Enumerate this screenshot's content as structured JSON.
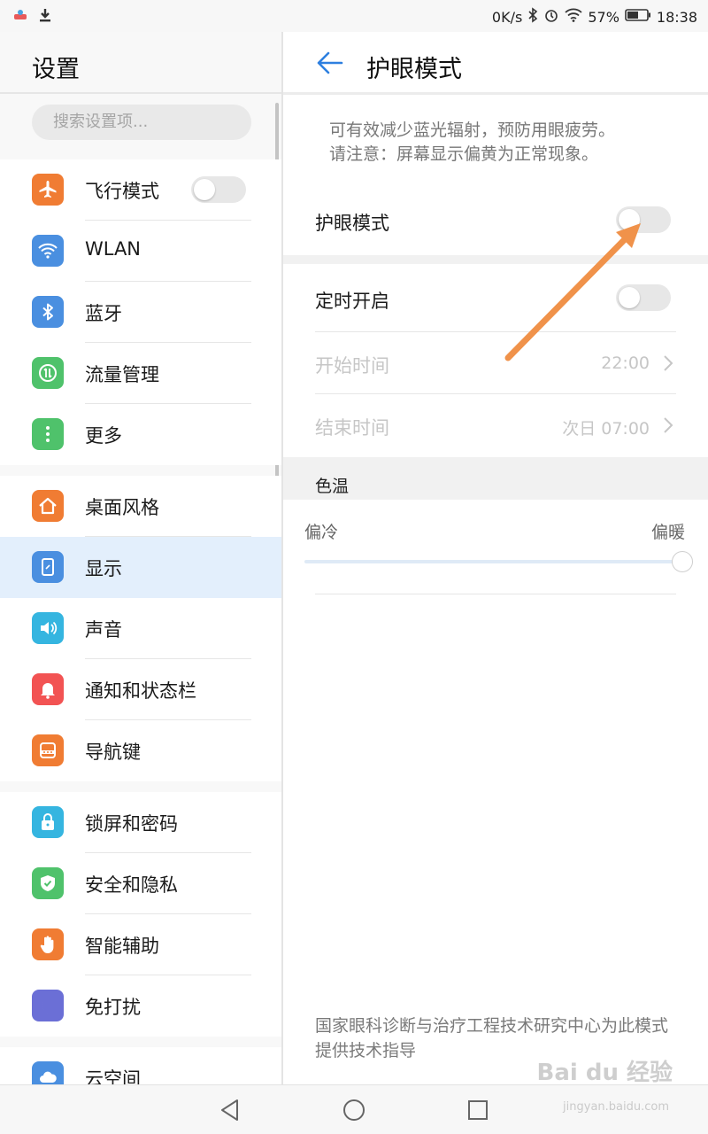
{
  "status_bar": {
    "speed": "0K/s",
    "battery": "57%",
    "time": "18:38"
  },
  "left_panel": {
    "title": "设置",
    "search_placeholder": "搜索设置项...",
    "groups": [
      {
        "items": [
          {
            "label": "飞行模式",
            "icon": "airplane-icon",
            "color": "#f07c33",
            "toggle": false
          },
          {
            "label": "WLAN",
            "icon": "wifi-icon",
            "color": "#4a8fe0"
          },
          {
            "label": "蓝牙",
            "icon": "bluetooth-icon",
            "color": "#4a8fe0"
          },
          {
            "label": "流量管理",
            "icon": "data-usage-icon",
            "color": "#4fc26b"
          },
          {
            "label": "更多",
            "icon": "more-icon",
            "color": "#4fc26b"
          }
        ]
      },
      {
        "items": [
          {
            "label": "桌面风格",
            "icon": "home-icon",
            "color": "#f07c33"
          },
          {
            "label": "显示",
            "icon": "display-icon",
            "color": "#4a8fe0",
            "active": true
          },
          {
            "label": "声音",
            "icon": "sound-icon",
            "color": "#35b5e0"
          },
          {
            "label": "通知和状态栏",
            "icon": "bell-icon",
            "color": "#f25353"
          },
          {
            "label": "导航键",
            "icon": "navigation-key-icon",
            "color": "#f07c33"
          }
        ]
      },
      {
        "items": [
          {
            "label": "锁屏和密码",
            "icon": "lock-icon",
            "color": "#35b5e0"
          },
          {
            "label": "安全和隐私",
            "icon": "shield-icon",
            "color": "#4fc26b"
          },
          {
            "label": "智能辅助",
            "icon": "hand-icon",
            "color": "#f07c33"
          },
          {
            "label": "免打扰",
            "icon": "moon-icon",
            "color": "#6b6fd6"
          }
        ]
      },
      {
        "items": [
          {
            "label": "云空间",
            "icon": "cloud-icon",
            "color": "#4a8fe0"
          }
        ]
      }
    ]
  },
  "right_panel": {
    "title": "护眼模式",
    "description_line1": "可有效减少蓝光辐射，预防用眼疲劳。",
    "description_line2": "请注意：屏幕显示偏黄为正常现象。",
    "eye_mode_label": "护眼模式",
    "eye_mode_on": false,
    "schedule_label": "定时开启",
    "schedule_on": false,
    "start_time_label": "开始时间",
    "start_time_value": "22:00",
    "end_time_label": "结束时间",
    "end_time_value": "次日 07:00",
    "color_temp_label": "色温",
    "cool_label": "偏冷",
    "warm_label": "偏暖",
    "color_temp_level": 1.0,
    "footnote": "国家眼科诊断与治疗工程技术研究中心为此模式提供技术指导"
  },
  "watermark": {
    "text": "Bai du 经验",
    "sub": "jingyan.baidu.com"
  },
  "colors": {
    "accent": "#2d7fe0",
    "annotation_arrow": "#f0924a"
  }
}
